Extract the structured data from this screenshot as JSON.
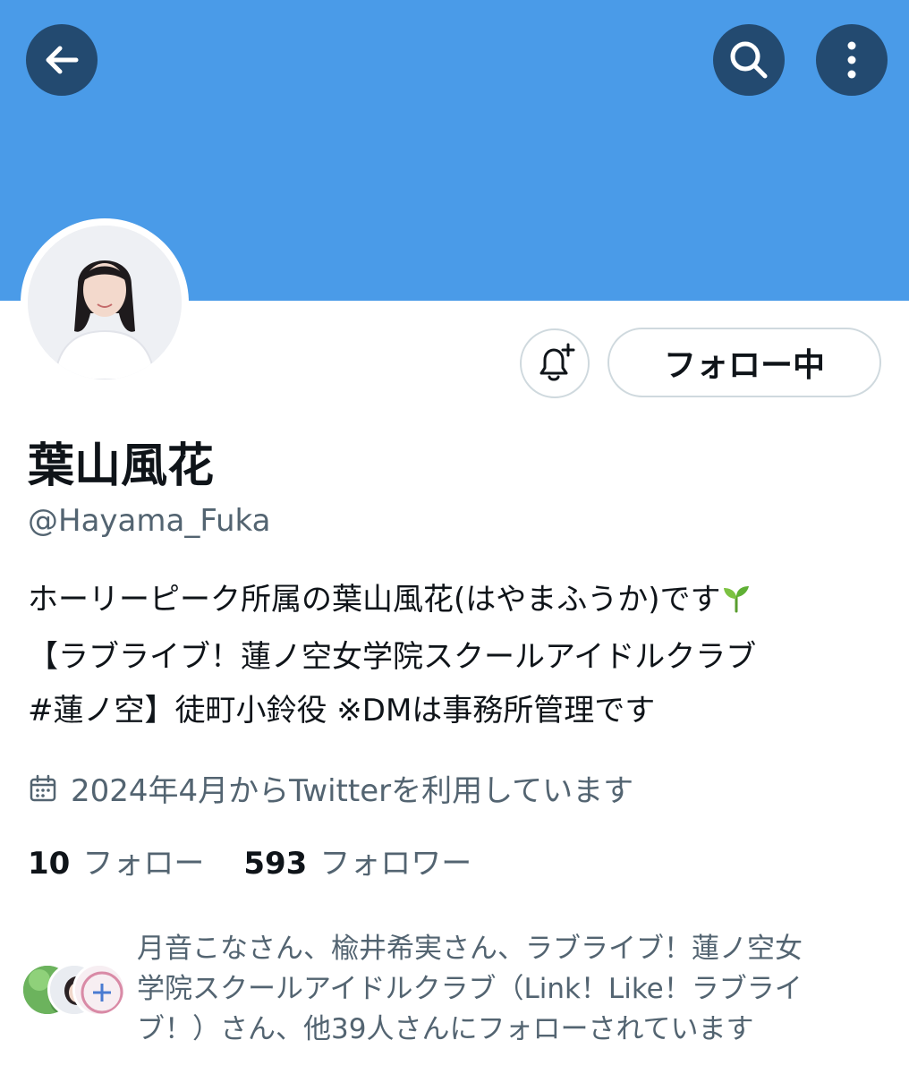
{
  "profile": {
    "display_name": "葉山風花",
    "handle": "@Hayama_Fuka",
    "bio_lines": [
      "ホーリーピーク所属の葉山風花(はやまふうか)です",
      "【ラブライブ！蓮ノ空女学院スクールアイドルクラブ",
      "#蓮ノ空】徒町小鈴役 ※DMは事務所管理です"
    ],
    "joined": "2024年4月からTwitterを利用しています",
    "following_count": "10",
    "following_label": "フォロー",
    "followers_count": "593",
    "followers_label": "フォロワー"
  },
  "actions": {
    "follow_label": "フォロー中"
  },
  "followed_by": {
    "lines": [
      "月音こなさん、楡井希実さん、ラブライブ！蓮ノ空女",
      "学院スクールアイドルクラブ（Link！Like！ラブライ",
      "ブ！）さん、他39人さんにフォローされています"
    ]
  },
  "colors": {
    "banner": "#4a9be8",
    "header_button": "#234a70",
    "secondary_text": "#536471",
    "border": "#cfd9de"
  },
  "icons": {
    "back": "arrow-left-icon",
    "search": "search-icon",
    "more": "more-vertical-icon",
    "notify": "bell-plus-icon",
    "calendar": "calendar-icon",
    "bio_emoji": "seedling-icon"
  }
}
